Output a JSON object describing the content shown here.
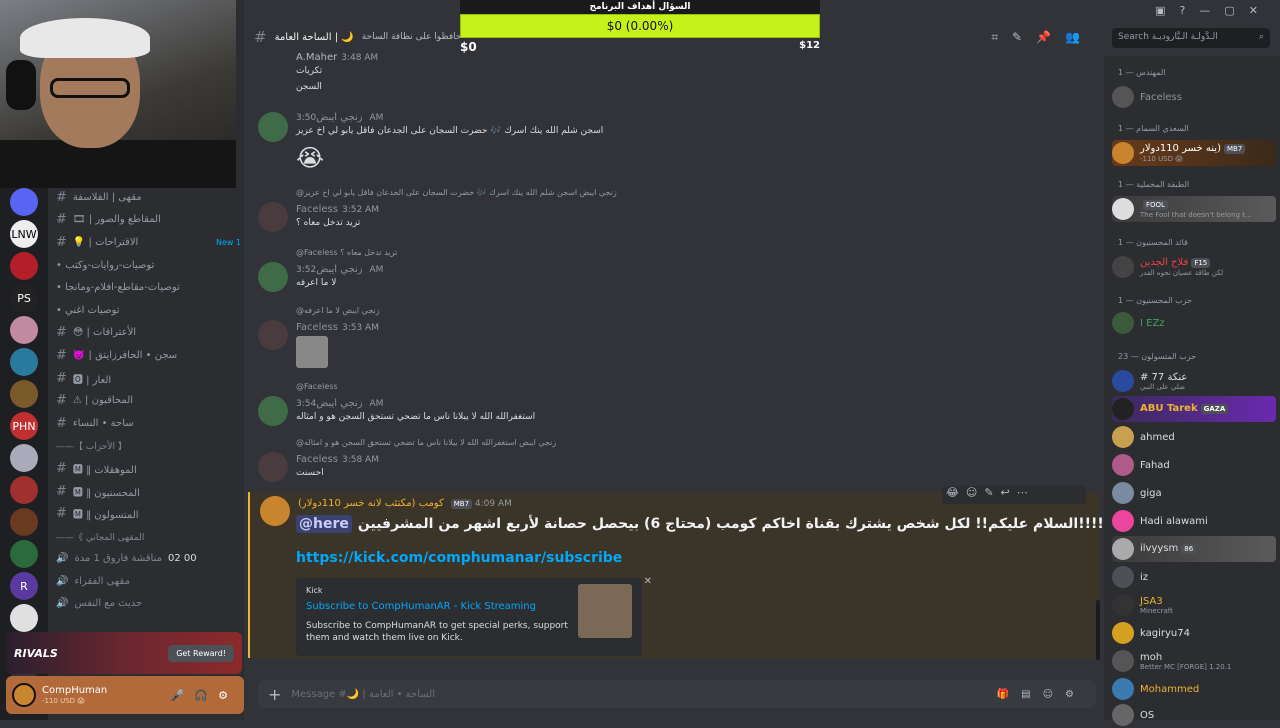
{
  "donation": {
    "title": "السؤال أهداف البرنامج",
    "amount_label": "$0 (0.00%)",
    "min": "$0",
    "max": "$12",
    "progress": 0
  },
  "header": {
    "channel": "الساحة العامة | 🌙",
    "topic": "حافظوا على نظافة الساحة"
  },
  "search": {
    "placeholder": "Search الـدَّولـة الـبَّاروديـة"
  },
  "channels": [
    {
      "label": "مقهى | الفلاسفة",
      "type": "text"
    },
    {
      "label": "المقاطع والصور | 🎞",
      "type": "text"
    },
    {
      "label": "الاقتراحات | 💡",
      "type": "text",
      "badge": "1 New"
    },
    {
      "label": "توصيات-روايات-وكتب •",
      "type": "thread"
    },
    {
      "label": "توصيات-مقاطع-افلام-ومانجا •",
      "type": "thread"
    },
    {
      "label": "توصيات اغني •",
      "type": "thread"
    },
    {
      "label": "الأعترافات | 😳",
      "type": "text"
    },
    {
      "label": "سجن • الحافرزايتق | 👿",
      "type": "text"
    },
    {
      "label": "العار | 🅾",
      "type": "text"
    },
    {
      "label": "المحاقبون | ⚠",
      "type": "text"
    },
    {
      "label": "ساحة • النساء",
      "type": "text"
    },
    {
      "label": "【 الأحزاب 】——",
      "type": "category"
    },
    {
      "label": "الموهقلات ‖ 🅼",
      "type": "text"
    },
    {
      "label": "المحسنيون ‖ 🅼",
      "type": "text"
    },
    {
      "label": "المتسولون ‖ 🅼",
      "type": "text"
    },
    {
      "label": "المقهى المجاني 》——",
      "type": "category"
    },
    {
      "label": "مناقشة فاروق 1 مدة",
      "type": "voice",
      "count": "00 02"
    },
    {
      "label": "مقهى الفقراء",
      "type": "voice"
    },
    {
      "label": "حديث مع النفس",
      "type": "voice"
    }
  ],
  "promo": {
    "logo": "RIVALS",
    "button": "Get Reward!"
  },
  "user": {
    "name": "CompHuman",
    "status": "-110 USD 😱"
  },
  "messages": {
    "m1": {
      "user": "A.Maher",
      "time": "3:48 AM",
      "line1": "تكريات",
      "line2": "السجن"
    },
    "m2": {
      "user": "زنجي ايبض",
      "time": "3:50 AM",
      "text": "اسجن شلم الله ينك اسرك 🎶 حضرت السجان على الجدعان فاقل يابو لي اخ عزيز"
    },
    "m3": {
      "reply": "@زنجي ايبض اسجن شلم الله ينك اسرك 🎶 حضرت السجان على الجدعان فاقل يابو لي اخ عزيز",
      "user": "Faceless",
      "time": "3:52 AM",
      "text": "تريد تدخل معاه ؟"
    },
    "m4": {
      "reply": "@Faceless تريد تدخل معاه ؟",
      "user": "زنجي ايبض",
      "time": "3:52 AM",
      "text": "لا ما اعرفه"
    },
    "m5": {
      "reply": "@زنجي ايبض لا ما اعرفه",
      "user": "Faceless",
      "time": "3:53 AM"
    },
    "m6": {
      "reply": "@Faceless",
      "user": "زنجي ايبض",
      "time": "3:54 AM",
      "text": "استغفرالله الله لا يبلانا ناس ما تضحي تستحق السجن هو و امثاله"
    },
    "m7": {
      "reply": "@زنجي ايبض استغفرالله الله لا يبلانا ناس ما تضحي تستحق السجن هو و امثاله",
      "user": "Faceless",
      "time": "3:58 AM",
      "text": "احسنت"
    },
    "m8": {
      "user": "كومب (مكتئب لانه خسر 110دولار)",
      "tag": "MB7",
      "time": "4:09 AM",
      "mention": "@here",
      "text": "السلام عليكم!! لكل شخص يشترك بقناة اخاكم كومب (محتاج 6) بيحصل حصانة لأربع اشهر من المشرفيين!!!!",
      "link": "https://kick.com/comphumanar/subscribe"
    }
  },
  "embed": {
    "provider": "Kick",
    "title": "Subscribe to CompHumanAR - Kick Streaming",
    "desc": "Subscribe to CompHumanAR to get special perks, support them and watch them live on Kick."
  },
  "compose": {
    "placeholder": "Message #🌙 | الساحة • العامة"
  },
  "members": {
    "groups": [
      {
        "label": "المهندس — 1"
      },
      {
        "label": "السعدي السمام — 1"
      },
      {
        "label": "الطبقة المخملية — 1"
      },
      {
        "label": "قائد المحسنيون — 1"
      },
      {
        "label": "حزب المحسنيون — 1"
      },
      {
        "label": "حزب المتسولون — 23"
      }
    ],
    "list": [
      {
        "name": "Faceless",
        "sub": ""
      },
      {
        "name": "ينه خسر 110دولار)",
        "sub": "-110 USD 😱",
        "tag": "MB7"
      },
      {
        "name": "FOOL",
        "sub": "The Fool that doesn't belong t..."
      },
      {
        "name": "فلاح الجدين",
        "sub": "لكن طاقة عصيان نحوه القدر",
        "tag": "F15"
      },
      {
        "name": "I EZz",
        "sub": ""
      },
      {
        "name": "# 77 عنكة",
        "sub": "صلي على النبي"
      },
      {
        "name": "ABU Tarek",
        "sub": "",
        "tag": "GAZA"
      },
      {
        "name": "ahmed",
        "sub": ""
      },
      {
        "name": "Fahad",
        "sub": ""
      },
      {
        "name": "giga",
        "sub": ""
      },
      {
        "name": "Hadi alawami",
        "sub": ""
      },
      {
        "name": "ilvyysm",
        "sub": "",
        "tag": "86"
      },
      {
        "name": "iz",
        "sub": ""
      },
      {
        "name": "JSA3",
        "sub": "Minecraft"
      },
      {
        "name": "kagiryu74",
        "sub": ""
      },
      {
        "name": "moh",
        "sub": "Better MC [FORGE] 1.20.1"
      },
      {
        "name": "Mohammed",
        "sub": ""
      },
      {
        "name": "OS",
        "sub": ""
      }
    ]
  }
}
